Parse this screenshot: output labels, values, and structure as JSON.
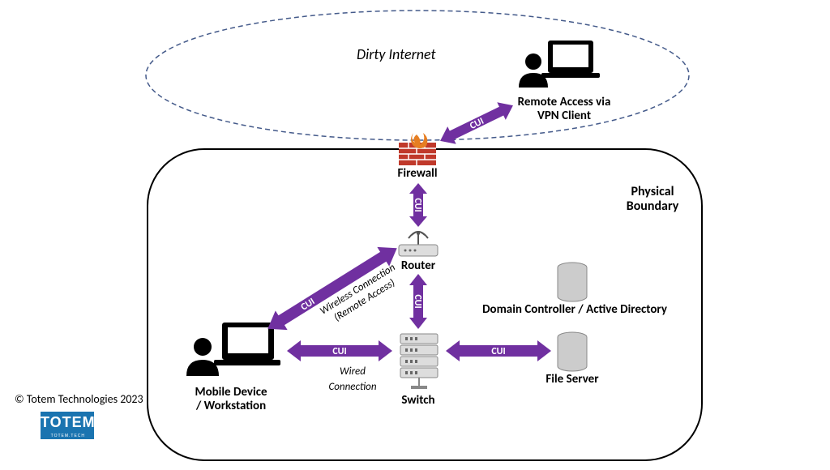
{
  "zones": {
    "dirty_internet": "Dirty Internet",
    "physical_boundary_line1": "Physical",
    "physical_boundary_line2": "Boundary"
  },
  "nodes": {
    "remote_access_line1": "Remote Access via",
    "remote_access_line2": "VPN Client",
    "firewall": "Firewall",
    "router": "Router",
    "switch": "Switch",
    "domain_controller": "Domain Controller / Active Directory",
    "file_server": "File Server",
    "workstation_line1": "Mobile Device",
    "workstation_line2": "/ Workstation"
  },
  "arrows": {
    "cui": "CUI",
    "wireless_line1": "Wireless Connection",
    "wireless_line2": "(Remote Access)",
    "wired_line1": "Wired",
    "wired_line2": "Connection"
  },
  "footer": {
    "copyright": "© Totem Technologies 2023",
    "logo_big": "TOTEM",
    "logo_small": "TOTEM.TECH"
  },
  "colors": {
    "arrow": "#7030A0",
    "firewall_brick": "#C0392B",
    "firewall_flame": "#E67E22",
    "boundary_dash": "#445a8a"
  }
}
